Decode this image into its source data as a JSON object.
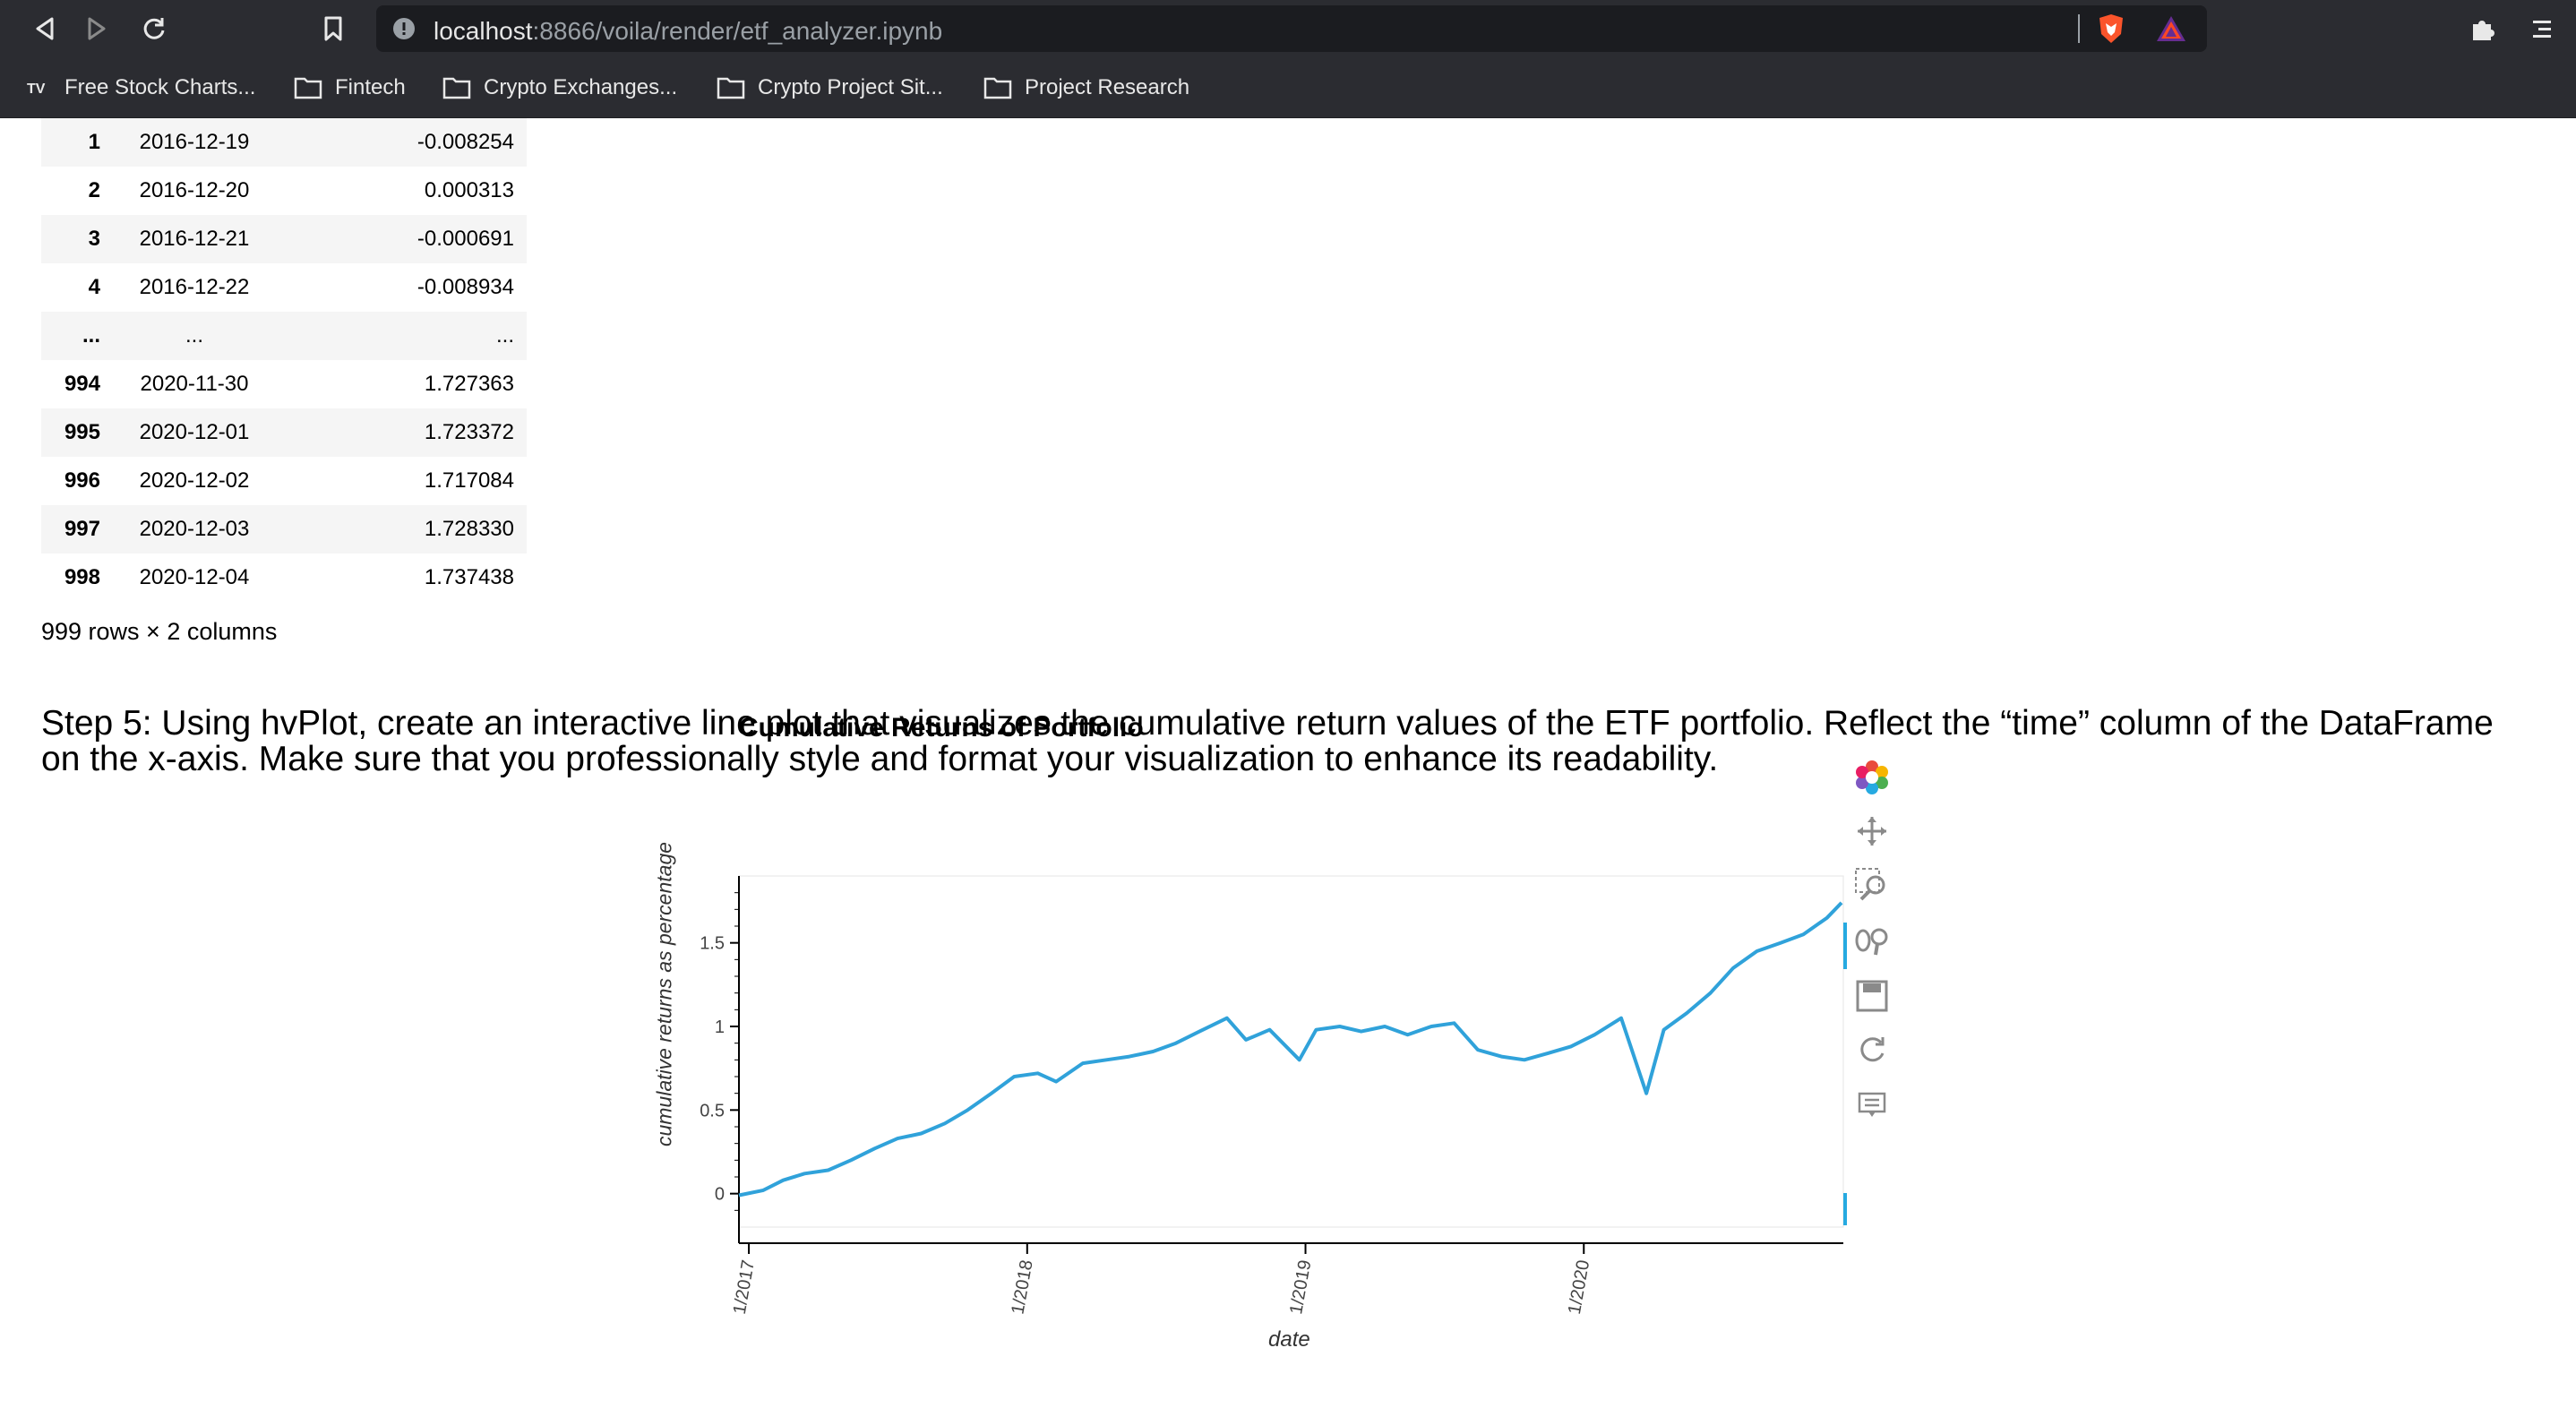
{
  "browser": {
    "url_host": "localhost",
    "url_path": ":8866/voila/render/etf_analyzer.ipynb",
    "bookmarks": [
      {
        "label": "Free Stock Charts...",
        "icon": "tradingview-icon"
      },
      {
        "label": "Fintech",
        "icon": "folder-icon"
      },
      {
        "label": "Crypto Exchanges...",
        "icon": "folder-icon"
      },
      {
        "label": "Crypto Project Sit...",
        "icon": "folder-icon"
      },
      {
        "label": "Project Research",
        "icon": "folder-icon"
      }
    ]
  },
  "dataframe": {
    "rows": [
      {
        "index": "1",
        "date": "2016-12-19",
        "value": "-0.008254"
      },
      {
        "index": "2",
        "date": "2016-12-20",
        "value": "0.000313"
      },
      {
        "index": "3",
        "date": "2016-12-21",
        "value": "-0.000691"
      },
      {
        "index": "4",
        "date": "2016-12-22",
        "value": "-0.008934"
      },
      {
        "index": "...",
        "date": "...",
        "value": "..."
      },
      {
        "index": "994",
        "date": "2020-11-30",
        "value": "1.727363"
      },
      {
        "index": "995",
        "date": "2020-12-01",
        "value": "1.723372"
      },
      {
        "index": "996",
        "date": "2020-12-02",
        "value": "1.717084"
      },
      {
        "index": "997",
        "date": "2020-12-03",
        "value": "1.728330"
      },
      {
        "index": "998",
        "date": "2020-12-04",
        "value": "1.737438"
      }
    ],
    "row_count_text": "999 rows × 2 columns"
  },
  "step_heading": "Step 5: Using hvPlot, create an interactive line plot that visualizes the cumulative return values of the ETF portfolio. Reflect the “time” column of the DataFrame on the x-axis. Make sure that you professionally style and format your visualization to enhance its readability.",
  "chart_data": {
    "type": "line",
    "title": "Cumulative Returns of Portfolio",
    "xlabel": "date",
    "ylabel": "cumulative returns as percentage",
    "x_ticks": [
      "1/2017",
      "1/2018",
      "1/2019",
      "1/2020"
    ],
    "y_ticks": [
      "0",
      "0.5",
      "1",
      "1.5"
    ],
    "ylim": [
      -0.2,
      1.9
    ],
    "xlim": [
      "2016-12-19",
      "2020-12-04"
    ],
    "grid": false,
    "color": "#30a2da",
    "series": [
      {
        "x": [
          "2016-12-19",
          "2017-01-20",
          "2017-02-15",
          "2017-03-15",
          "2017-04-15",
          "2017-05-15",
          "2017-06-15",
          "2017-07-15",
          "2017-08-15",
          "2017-09-15",
          "2017-10-15",
          "2017-11-15",
          "2017-12-15",
          "2018-01-15",
          "2018-02-08",
          "2018-03-15",
          "2018-04-15",
          "2018-05-15",
          "2018-06-15",
          "2018-07-15",
          "2018-08-15",
          "2018-09-20",
          "2018-10-15",
          "2018-11-15",
          "2018-12-24",
          "2019-01-15",
          "2019-02-15",
          "2019-03-15",
          "2019-04-15",
          "2019-05-15",
          "2019-06-15",
          "2019-07-15",
          "2019-08-15",
          "2019-09-15",
          "2019-10-15",
          "2019-11-15",
          "2019-12-15",
          "2020-01-15",
          "2020-02-19",
          "2020-03-23",
          "2020-04-15",
          "2020-05-15",
          "2020-06-15",
          "2020-07-15",
          "2020-08-15",
          "2020-09-15",
          "2020-10-15",
          "2020-11-15",
          "2020-12-04"
        ],
        "y": [
          -0.01,
          0.02,
          0.08,
          0.12,
          0.14,
          0.2,
          0.27,
          0.33,
          0.36,
          0.42,
          0.5,
          0.6,
          0.7,
          0.72,
          0.67,
          0.78,
          0.8,
          0.82,
          0.85,
          0.9,
          0.97,
          1.05,
          0.92,
          0.98,
          0.8,
          0.98,
          1.0,
          0.97,
          1.0,
          0.95,
          1.0,
          1.02,
          0.86,
          0.82,
          0.8,
          0.84,
          0.88,
          0.95,
          1.05,
          0.6,
          0.98,
          1.08,
          1.2,
          1.35,
          1.45,
          1.5,
          1.55,
          1.65,
          1.74
        ]
      }
    ]
  }
}
